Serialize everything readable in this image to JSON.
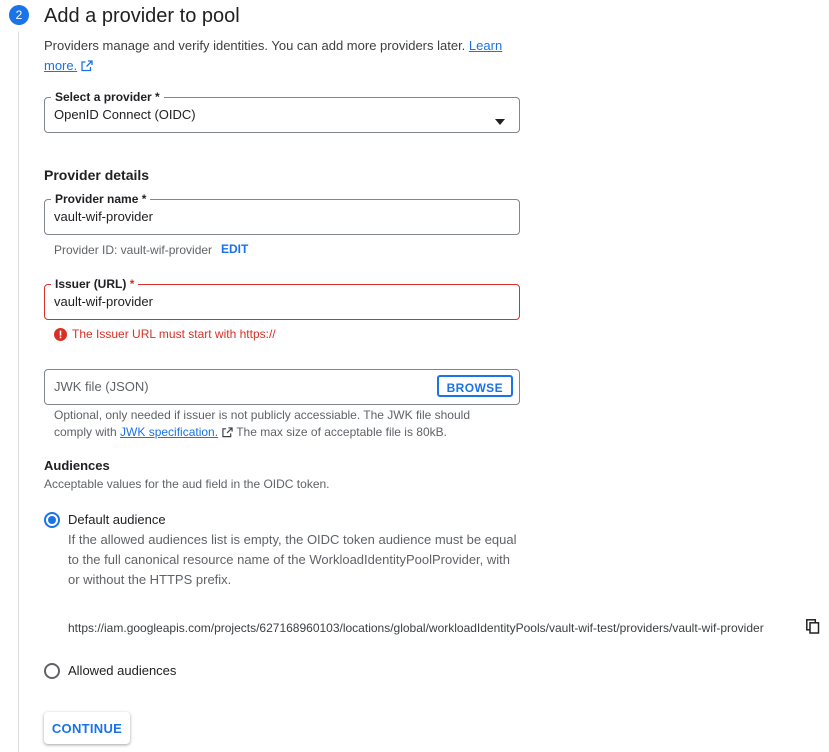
{
  "step": {
    "number": "2",
    "title": "Add a provider to pool",
    "description": "Providers manage and verify identities. You can add more providers later.",
    "learn_more_part1": "Learn",
    "learn_more_part2": "more."
  },
  "select_provider": {
    "label": "Select a provider *",
    "value": "OpenID Connect (OIDC)"
  },
  "provider_details": {
    "heading": "Provider details",
    "name_label": "Provider name *",
    "name_value": "vault-wif-provider",
    "provider_id_text": "Provider ID: vault-wif-provider",
    "edit_label": "EDIT",
    "issuer_label": "Issuer (URL)",
    "issuer_required_mark": "*",
    "issuer_value": "vault-wif-provider",
    "issuer_error": "The Issuer URL must start with https://",
    "jwk_placeholder": "JWK file (JSON)",
    "browse_label": "BROWSE",
    "jwk_help_part1": "Optional, only needed if issuer is not publicly accessiable. The JWK file should comply with",
    "jwk_help_link": "JWK specification.",
    "jwk_help_part2": "The max size of acceptable file is 80kB."
  },
  "audiences": {
    "heading": "Audiences",
    "subtext": "Acceptable values for the aud field in the OIDC token.",
    "default_label": "Default audience",
    "default_desc": "If the allowed audiences list is empty, the OIDC token audience must be equal to the full canonical resource name of the WorkloadIdentityPoolProvider, with or without the HTTPS prefix.",
    "default_uri": "https://iam.googleapis.com/projects/627168960103/locations/global/workloadIdentityPools/vault-wif-test/providers/vault-wif-provider",
    "allowed_label": "Allowed audiences",
    "selected": "default"
  },
  "actions": {
    "continue_label": "CONTINUE"
  },
  "colors": {
    "accent": "#1a73e8",
    "error": "#d93025"
  }
}
